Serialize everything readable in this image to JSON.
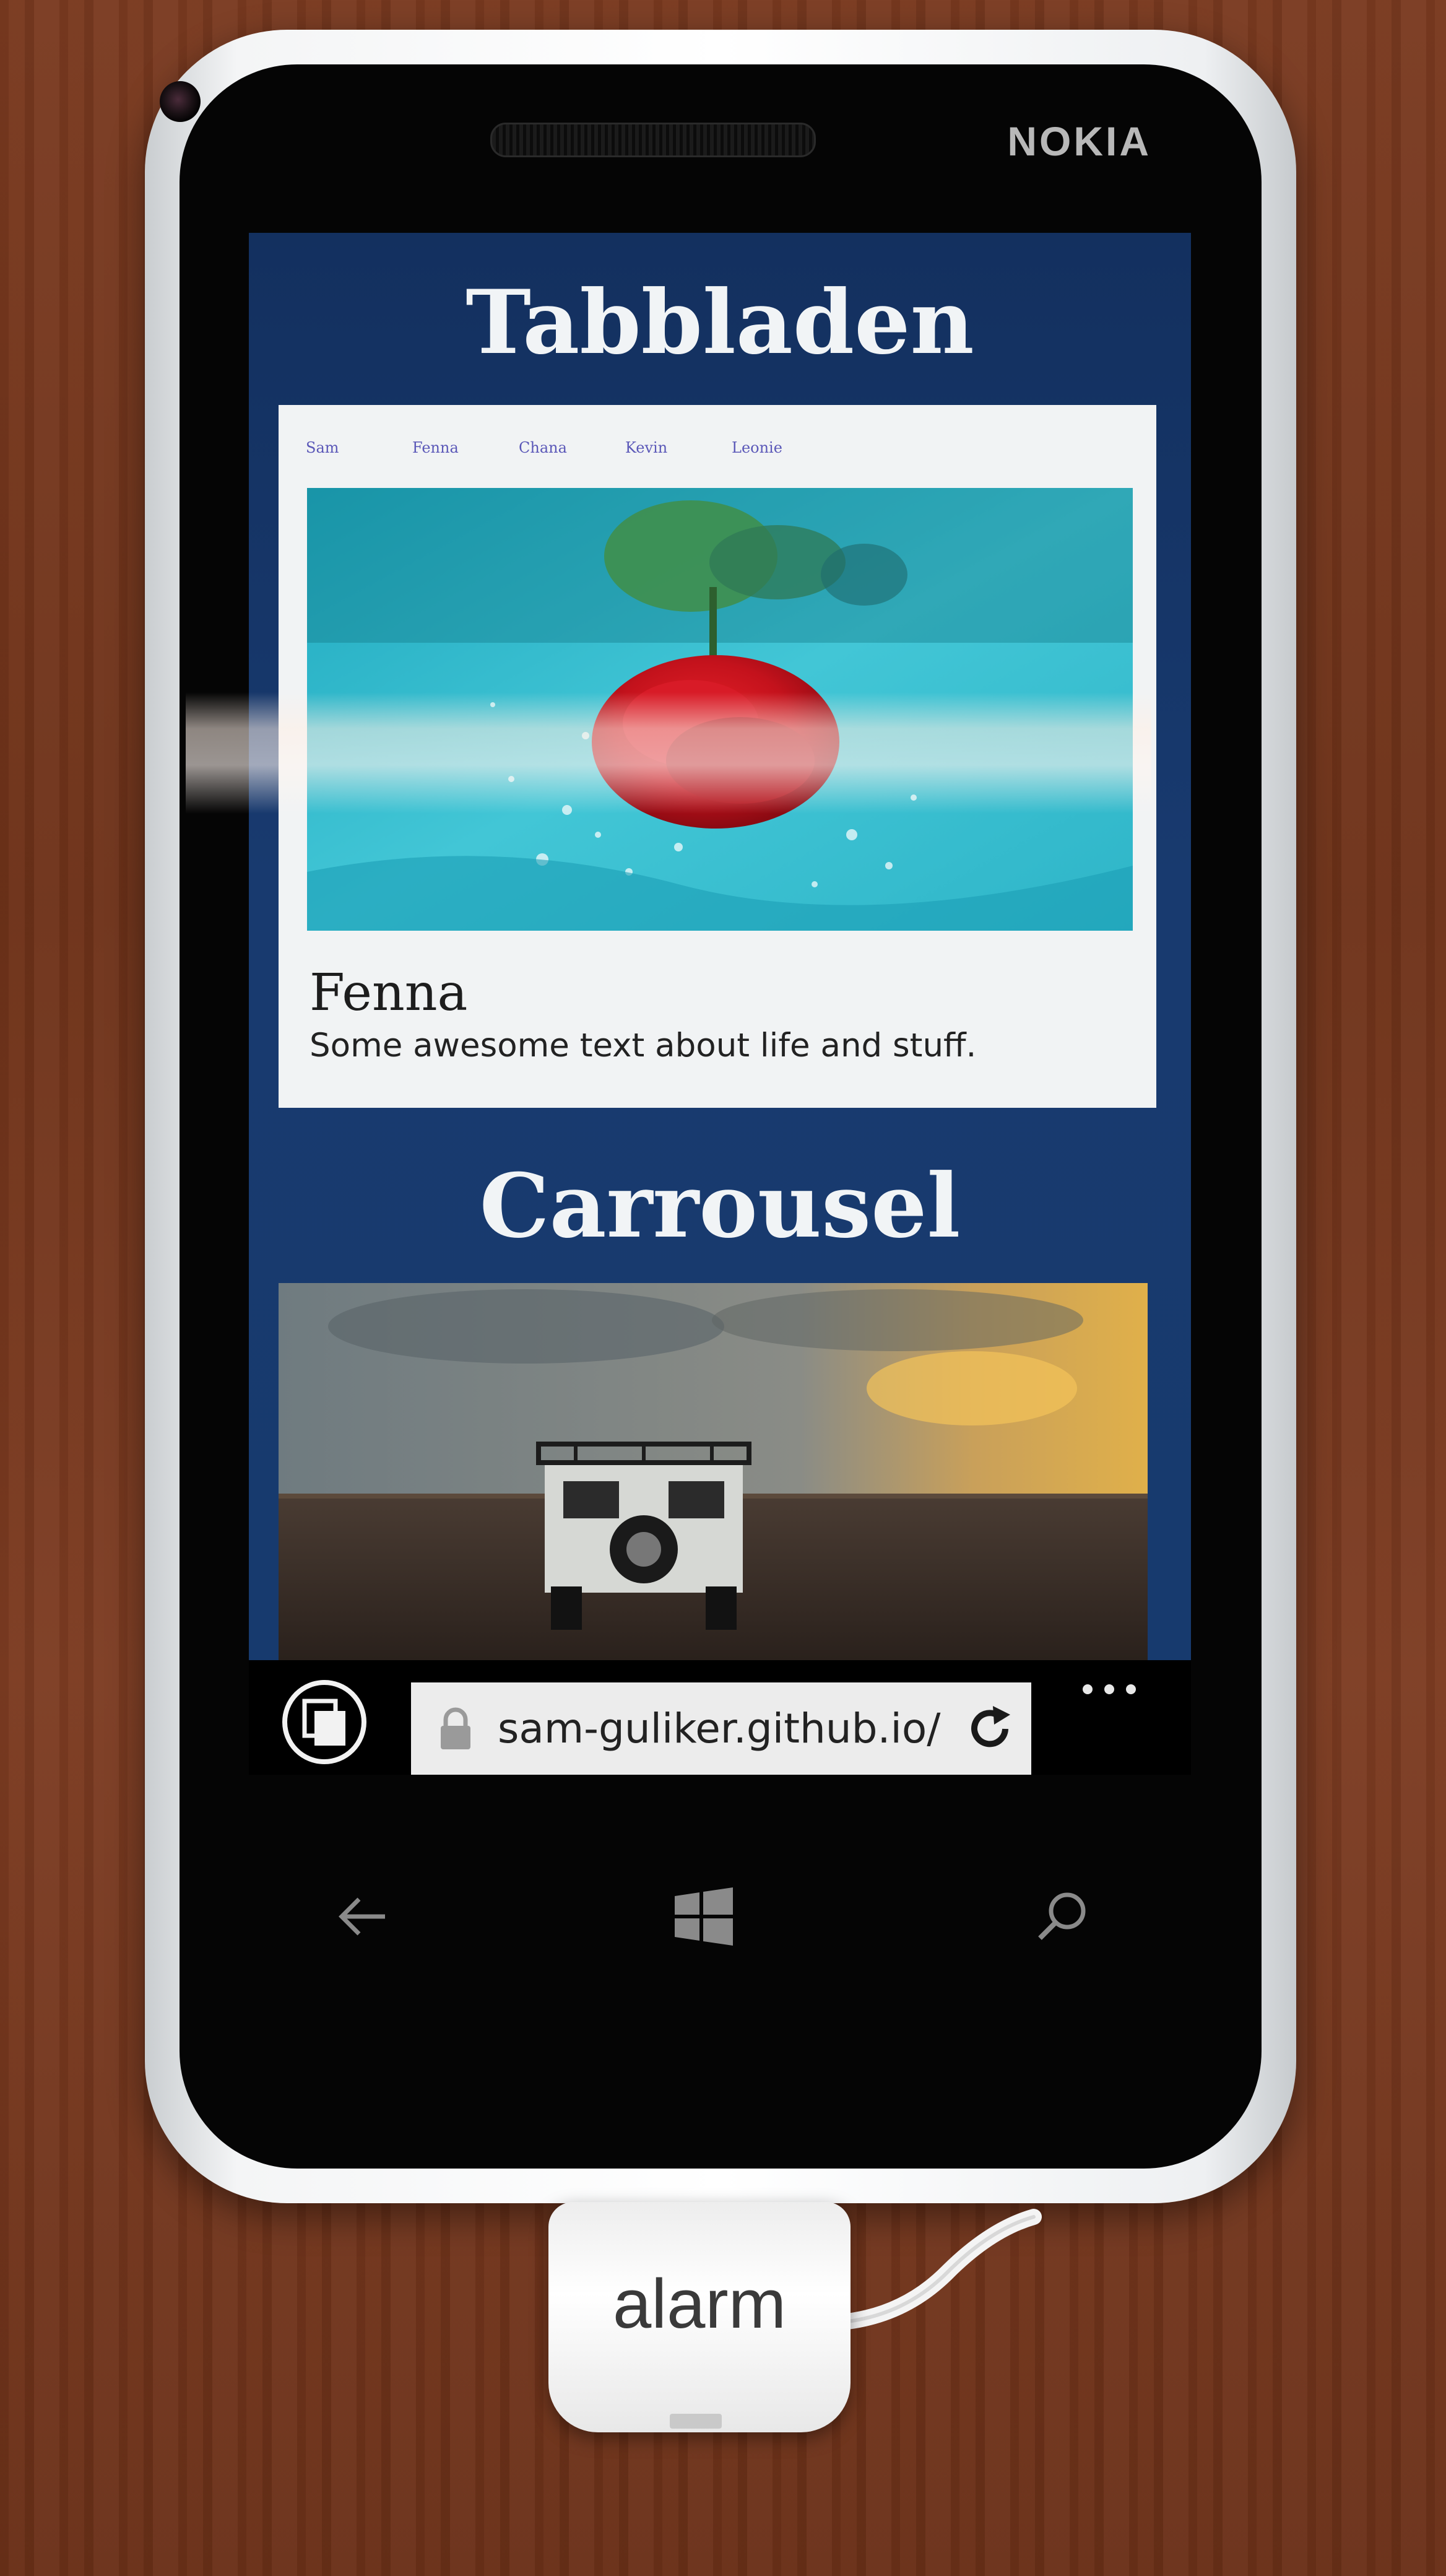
{
  "device": {
    "brand": "NOKIA"
  },
  "site": {
    "tabs_section_title": "Tabbladen",
    "tabs": [
      {
        "label": "Sam"
      },
      {
        "label": "Fenna"
      },
      {
        "label": "Chana"
      },
      {
        "label": "Kevin"
      },
      {
        "label": "Leonie"
      }
    ],
    "active_tab": "Fenna",
    "active_person_name": "Fenna",
    "active_person_text": "Some awesome text about life and stuff.",
    "carousel_section_title": "Carrousel"
  },
  "browser": {
    "url": "sam-guliker.github.io/",
    "icons": [
      "tabs-icon",
      "lock-icon",
      "refresh-icon",
      "more-icon"
    ]
  },
  "navbar": {
    "icons": [
      "back-arrow-icon",
      "windows-start-icon",
      "search-icon"
    ]
  },
  "accessory": {
    "alarm_label": "alarm"
  }
}
